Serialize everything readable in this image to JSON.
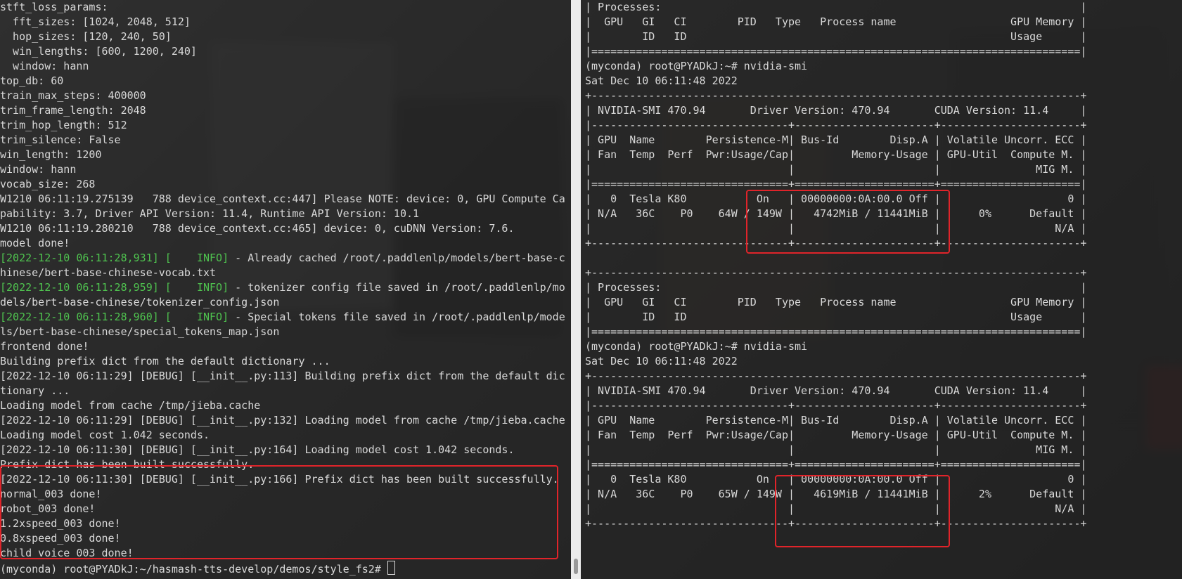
{
  "left_terminal": {
    "lines": [
      "stft_loss_params:",
      "  fft_sizes: [1024, 2048, 512]",
      "  hop_sizes: [120, 240, 50]",
      "  win_lengths: [600, 1200, 240]",
      "  window: hann",
      "top_db: 60",
      "train_max_steps: 400000",
      "trim_frame_length: 2048",
      "trim_hop_length: 512",
      "trim_silence: False",
      "win_length: 1200",
      "window: hann",
      "vocab_size: 268",
      "W1210 06:11:19.275139   788 device_context.cc:447] Please NOTE: device: 0, GPU Compute Ca",
      "pability: 3.7, Driver API Version: 11.4, Runtime API Version: 10.1",
      "W1210 06:11:19.280210   788 device_context.cc:465] device: 0, cuDNN Version: 7.6.",
      "model done!"
    ],
    "info_lines": [
      {
        "prefix": "[2022-12-10 06:11:28,931] [    INFO]",
        "text": " - Already cached /root/.paddlenlp/models/bert-base-c"
      },
      {
        "prefix": "",
        "text": "hinese/bert-base-chinese-vocab.txt"
      },
      {
        "prefix": "[2022-12-10 06:11:28,959] [    INFO]",
        "text": " - tokenizer config file saved in /root/.paddlenlp/mo"
      },
      {
        "prefix": "",
        "text": "dels/bert-base-chinese/tokenizer_config.json"
      },
      {
        "prefix": "[2022-12-10 06:11:28,960] [    INFO]",
        "text": " - Special tokens file saved in /root/.paddlenlp/mode"
      },
      {
        "prefix": "",
        "text": "ls/bert-base-chinese/special_tokens_map.json"
      }
    ],
    "lines_after": [
      "frontend done!",
      "Building prefix dict from the default dictionary ...",
      "[2022-12-10 06:11:29] [DEBUG] [__init__.py:113] Building prefix dict from the default dic",
      "tionary ...",
      "Loading model from cache /tmp/jieba.cache",
      "[2022-12-10 06:11:29] [DEBUG] [__init__.py:132] Loading model from cache /tmp/jieba.cache",
      "Loading model cost 1.042 seconds.",
      "[2022-12-10 06:11:30] [DEBUG] [__init__.py:164] Loading model cost 1.042 seconds.",
      "Prefix dict has been built successfully.",
      "[2022-12-10 06:11:30] [DEBUG] [__init__.py:166] Prefix dict has been built successfully.",
      "normal_003 done!",
      "robot_003 done!",
      "1.2xspeed_003 done!",
      "0.8xspeed_003 done!",
      "child_voice_003 done!"
    ],
    "prompt": "(myconda) root@PYADkJ:~/hasmash-tts-develop/demos/style_fs2# "
  },
  "right_terminal": {
    "lines": [
      "| Processes:                                                                  |",
      "|  GPU   GI   CI        PID   Type   Process name                  GPU Memory |",
      "|        ID   ID                                                   Usage      |",
      "|=============================================================================|",
      "(myconda) root@PYADkJ:~# nvidia-smi",
      "Sat Dec 10 06:11:48 2022",
      "+-----------------------------------------------------------------------------+",
      "| NVIDIA-SMI 470.94       Driver Version: 470.94       CUDA Version: 11.4     |",
      "|-------------------------------+----------------------+----------------------+",
      "| GPU  Name        Persistence-M| Bus-Id        Disp.A | Volatile Uncorr. ECC |",
      "| Fan  Temp  Perf  Pwr:Usage/Cap|         Memory-Usage | GPU-Util  Compute M. |",
      "|                               |                      |               MIG M. |",
      "|===============================+======================+======================|",
      "|   0  Tesla K80           On   | 00000000:0A:00.0 Off |                    0 |",
      "| N/A   36C    P0    64W / 149W |   4742MiB / 11441MiB |      0%      Default |",
      "|                               |                      |                  N/A |",
      "+-------------------------------+----------------------+----------------------+",
      "",
      "+-----------------------------------------------------------------------------+",
      "| Processes:                                                                  |",
      "|  GPU   GI   CI        PID   Type   Process name                  GPU Memory |",
      "|        ID   ID                                                   Usage      |",
      "|=============================================================================|",
      "(myconda) root@PYADkJ:~# nvidia-smi",
      "Sat Dec 10 06:11:48 2022",
      "+-----------------------------------------------------------------------------+",
      "| NVIDIA-SMI 470.94       Driver Version: 470.94       CUDA Version: 11.4     |",
      "|-------------------------------+----------------------+----------------------+",
      "| GPU  Name        Persistence-M| Bus-Id        Disp.A | Volatile Uncorr. ECC |",
      "| Fan  Temp  Perf  Pwr:Usage/Cap|         Memory-Usage | GPU-Util  Compute M. |",
      "|                               |                      |               MIG M. |",
      "|===============================+======================+======================|",
      "|   0  Tesla K80           On   | 00000000:0A:00.0 Off |                    0 |",
      "| N/A   36C    P0    65W / 149W |   4619MiB / 11441MiB |      2%      Default |",
      "|                               |                      |                  N/A |",
      "+-------------------------------+----------------------+----------------------+"
    ]
  },
  "colors": {
    "terminal_text": "#d8d8d8",
    "info_green": "#4fc34f",
    "highlight_red": "#e0242a",
    "divider": "#ececec"
  }
}
